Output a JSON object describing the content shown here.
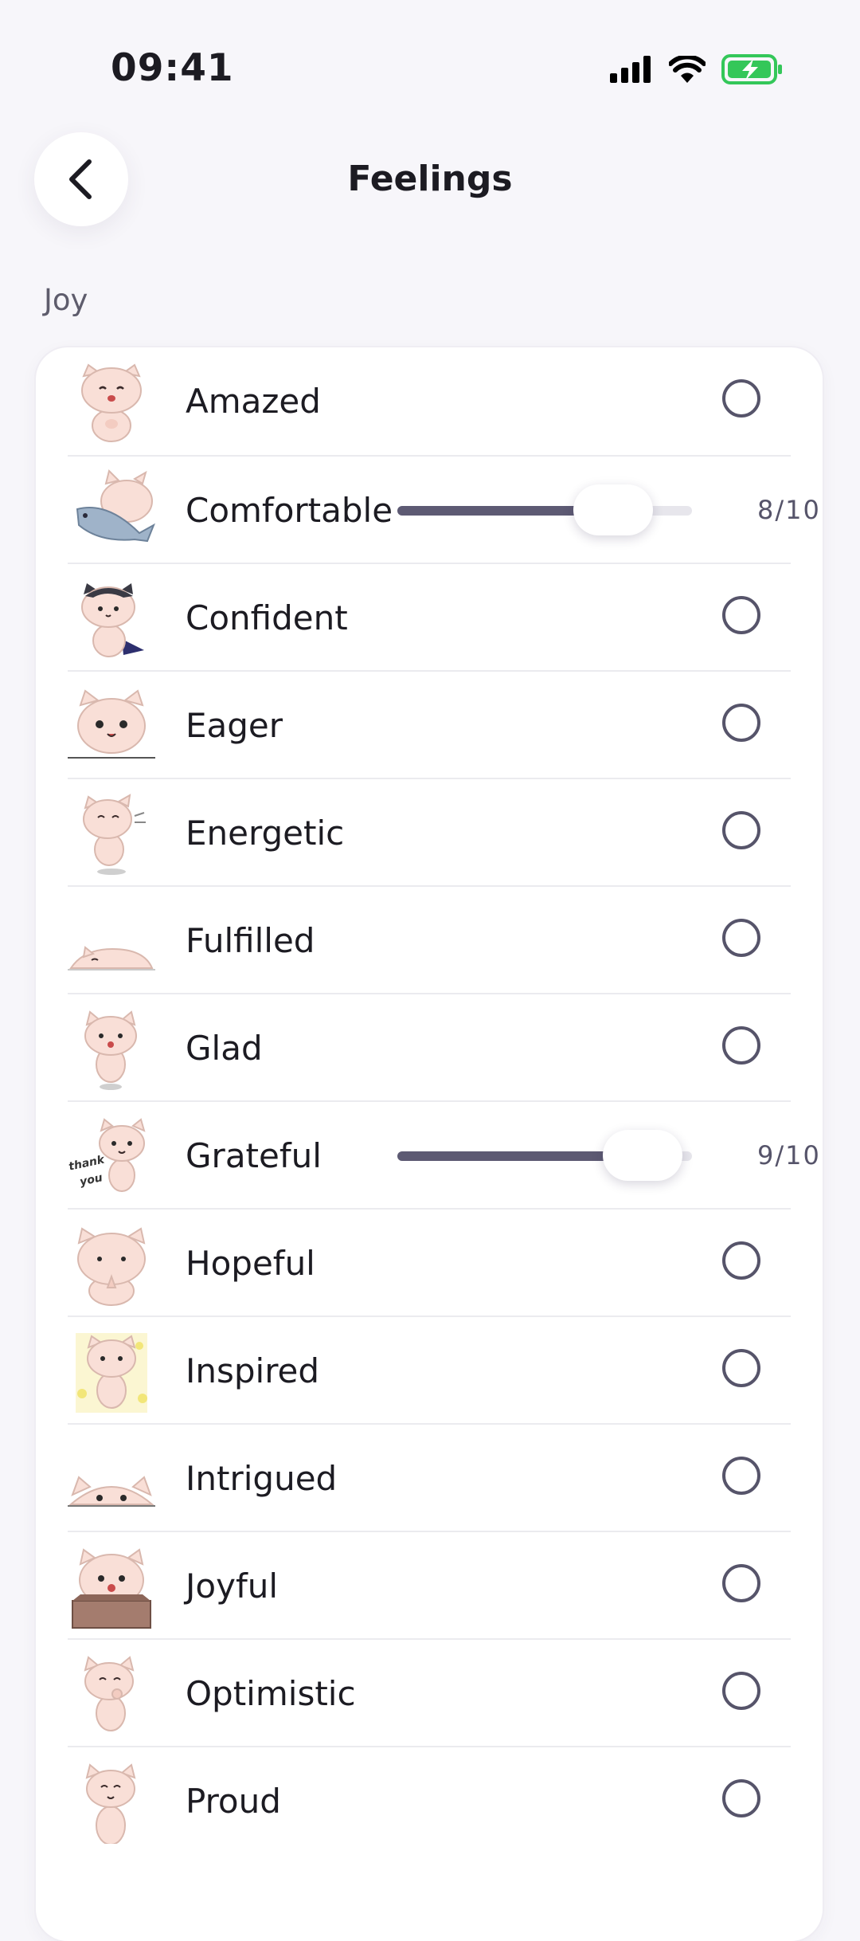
{
  "status_bar": {
    "time": "09:41",
    "battery_color": "#34c759"
  },
  "header": {
    "title": "Feelings",
    "back_icon": "chevron-left-icon"
  },
  "section": {
    "label": "Joy"
  },
  "feelings": [
    {
      "name": "Amazed",
      "control": "radio",
      "selected": false,
      "avatar": "cat-amazed-sticker"
    },
    {
      "name": "Comfortable",
      "control": "slider",
      "level": 8,
      "max": 10,
      "value_text": "8/10",
      "avatar": "cat-with-fish-sticker"
    },
    {
      "name": "Confident",
      "control": "radio",
      "selected": false,
      "avatar": "cat-superhero-sticker"
    },
    {
      "name": "Eager",
      "control": "radio",
      "selected": false,
      "avatar": "cat-peeking-sticker"
    },
    {
      "name": "Energetic",
      "control": "radio",
      "selected": false,
      "avatar": "cat-dancing-sticker"
    },
    {
      "name": "Fulfilled",
      "control": "radio",
      "selected": false,
      "avatar": "cat-lying-sticker"
    },
    {
      "name": "Glad",
      "control": "radio",
      "selected": false,
      "avatar": "cat-happy-sticker"
    },
    {
      "name": "Grateful",
      "control": "slider",
      "level": 9,
      "max": 10,
      "value_text": "9/10",
      "avatar": "cat-thank-you-sticker",
      "sticker_text": "thank you"
    },
    {
      "name": "Hopeful",
      "control": "radio",
      "selected": false,
      "avatar": "cat-praying-sticker"
    },
    {
      "name": "Inspired",
      "control": "radio",
      "selected": false,
      "avatar": "cat-sparkles-sticker"
    },
    {
      "name": "Intrigued",
      "control": "radio",
      "selected": false,
      "avatar": "cat-peeking-low-sticker"
    },
    {
      "name": "Joyful",
      "control": "radio",
      "selected": false,
      "avatar": "cat-in-box-sticker"
    },
    {
      "name": "Optimistic",
      "control": "radio",
      "selected": false,
      "avatar": "cat-thinking-sticker"
    },
    {
      "name": "Proud",
      "control": "radio",
      "selected": false,
      "avatar": "cat-proud-sticker"
    }
  ]
}
